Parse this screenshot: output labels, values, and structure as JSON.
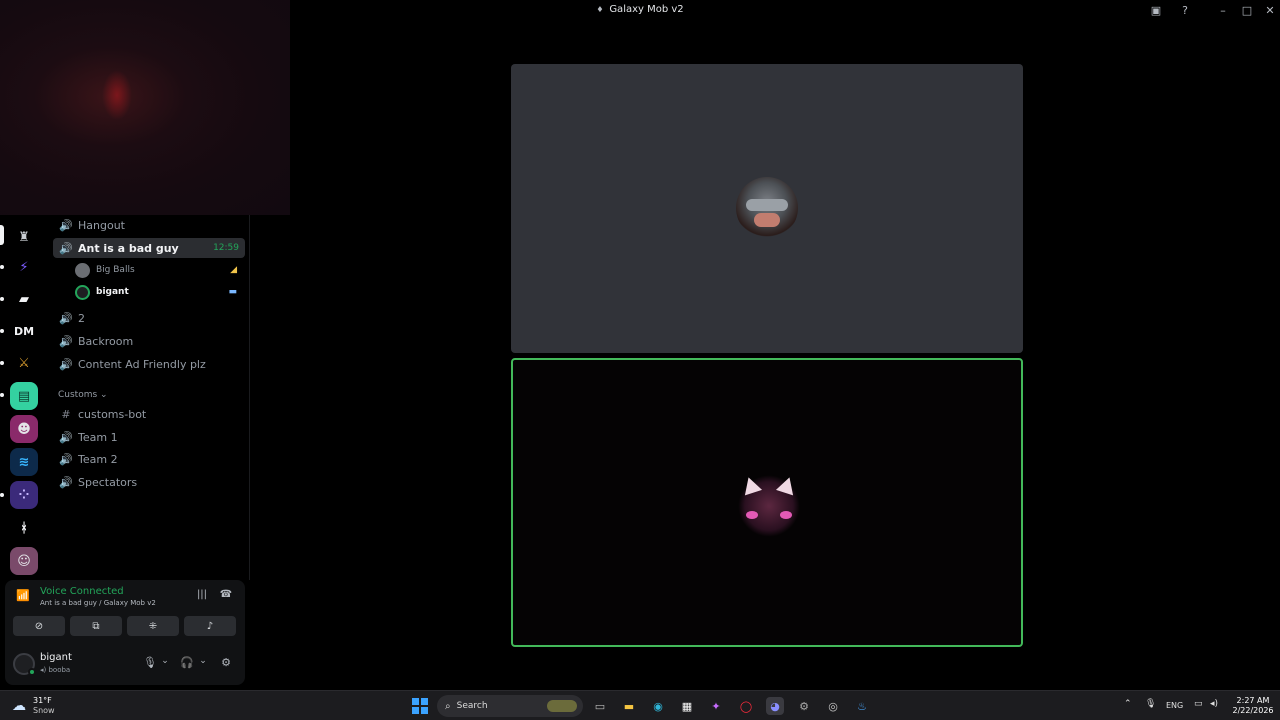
{
  "window": {
    "title": "Galaxy Mob v2"
  },
  "channels": {
    "voice_top": [
      {
        "name": "Hangout"
      }
    ],
    "active": {
      "name": "Ant is a bad guy",
      "timer": "12:59"
    },
    "members": [
      {
        "name": "Big Balls"
      },
      {
        "name": "bigant"
      }
    ],
    "voice_more": [
      {
        "name": "2"
      },
      {
        "name": "Backroom"
      },
      {
        "name": "Content Ad Friendly plz"
      }
    ],
    "category": {
      "label": "Customs"
    },
    "custom_channels": [
      {
        "name": "customs-bot",
        "type": "text"
      },
      {
        "name": "Team 1",
        "type": "voice"
      },
      {
        "name": "Team 2",
        "type": "voice"
      },
      {
        "name": "Spectators",
        "type": "voice"
      }
    ]
  },
  "servers": [
    {
      "abbr": "DM",
      "icon": "dm-icon"
    }
  ],
  "voice_panel": {
    "status": "Voice Connected",
    "location": "Ant is a bad guy / Galaxy Mob v2"
  },
  "user": {
    "name": "bigant",
    "status": "booba"
  },
  "taskbar": {
    "weather_temp": "31°F",
    "weather_desc": "Snow",
    "search_placeholder": "Search",
    "lang": "ENG",
    "time": "2:27 AM",
    "date": "2/22/2026"
  },
  "colors": {
    "accent_green": "#23a55a",
    "speaking_border": "#43b95a",
    "tile_bg": "#313339"
  }
}
